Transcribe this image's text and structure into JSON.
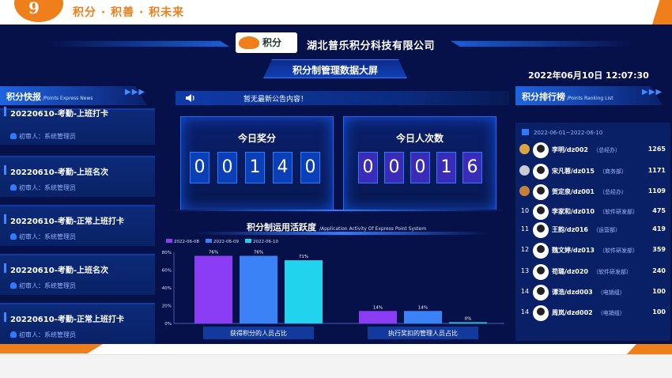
{
  "banner": {
    "slogan": "积分 · 积善 · 积未来",
    "logo_mark": "9"
  },
  "header": {
    "company": "湖北普乐积分科技有限公司",
    "logo_text": "积分",
    "screen_title": "积分制管理数据大屏",
    "datetime": "2022年06月10日 12:07:30"
  },
  "news_panel": {
    "title": "积分快报",
    "subtitle": "/Points Express News",
    "items": [
      {
        "title": "20220610-考勤-上班打卡",
        "reviewer": "初审人：系统管理员"
      },
      {
        "title": "20220610-考勤-上班名次",
        "reviewer": "初审人：系统管理员"
      },
      {
        "title": "20220610-考勤-正常上班打卡",
        "reviewer": "初审人：系统管理员"
      },
      {
        "title": "20220610-考勤-上班名次",
        "reviewer": "初审人：系统管理员"
      },
      {
        "title": "20220610-考勤-正常上班打卡",
        "reviewer": "初审人：系统管理员"
      }
    ]
  },
  "notice": {
    "text": "暂无最新公告内容！"
  },
  "counters": {
    "today_points": {
      "label": "今日奖分",
      "digits": [
        "0",
        "0",
        "1",
        "4",
        "0"
      ]
    },
    "today_people": {
      "label": "今日人次数",
      "digits": [
        "0",
        "0",
        "0",
        "1",
        "6"
      ]
    }
  },
  "chart_title": {
    "main": "积分制运用活跃度",
    "sub": "/Application Activity Of Express Point System"
  },
  "chart_data": {
    "type": "bar",
    "categories": [
      "获得积分的人员占比",
      "执行奖扣的管理人员占比"
    ],
    "series": [
      {
        "name": "2022-06-08",
        "values": [
          76,
          14
        ],
        "labels": [
          "76%",
          "14%"
        ]
      },
      {
        "name": "2022-06-09",
        "values": [
          76,
          14
        ],
        "labels": [
          "76%",
          "14%"
        ]
      },
      {
        "name": "2022-06-10",
        "values": [
          71,
          0
        ],
        "labels": [
          "71%",
          "0%"
        ]
      }
    ],
    "ylim": [
      0,
      80
    ],
    "yticks": [
      "0%",
      "20%",
      "40%",
      "60%",
      "80%"
    ],
    "legend": "top-left",
    "colors": [
      "#8b3df5",
      "#3b82f6",
      "#22d3ee"
    ]
  },
  "ranking_panel": {
    "title": "积分排行榜",
    "subtitle": "/Points Ranking List",
    "date_range": "2022-06-01~2022-06-10",
    "rows": [
      {
        "rank": "1",
        "name": "李明/dz002",
        "dept": "（总经办）",
        "score": "1265"
      },
      {
        "rank": "2",
        "name": "宋凡蓉/dz015",
        "dept": "（商务部）",
        "score": "1171"
      },
      {
        "rank": "3",
        "name": "贺定泉/dz001",
        "dept": "（总经办）",
        "score": "1109"
      },
      {
        "rank": "10",
        "name": "李家和/dz010",
        "dept": "（软件研发部）",
        "score": "475"
      },
      {
        "rank": "11",
        "name": "王韵/dz016",
        "dept": "（运营部）",
        "score": "419"
      },
      {
        "rank": "12",
        "name": "魏文婷/dz013",
        "dept": "（软件研发部）",
        "score": "359"
      },
      {
        "rank": "13",
        "name": "苟璐/dz020",
        "dept": "（软件研发部）",
        "score": "240"
      },
      {
        "rank": "14",
        "name": "谭浩/dzd003",
        "dept": "（电销组）",
        "score": "100"
      },
      {
        "rank": "14",
        "name": "周岚/dzd002",
        "dept": "（电销组）",
        "score": "100"
      }
    ]
  },
  "colors": {
    "background": "#061149",
    "brand_orange": "#ee7f1b",
    "accent_blue": "#2f7bff"
  }
}
